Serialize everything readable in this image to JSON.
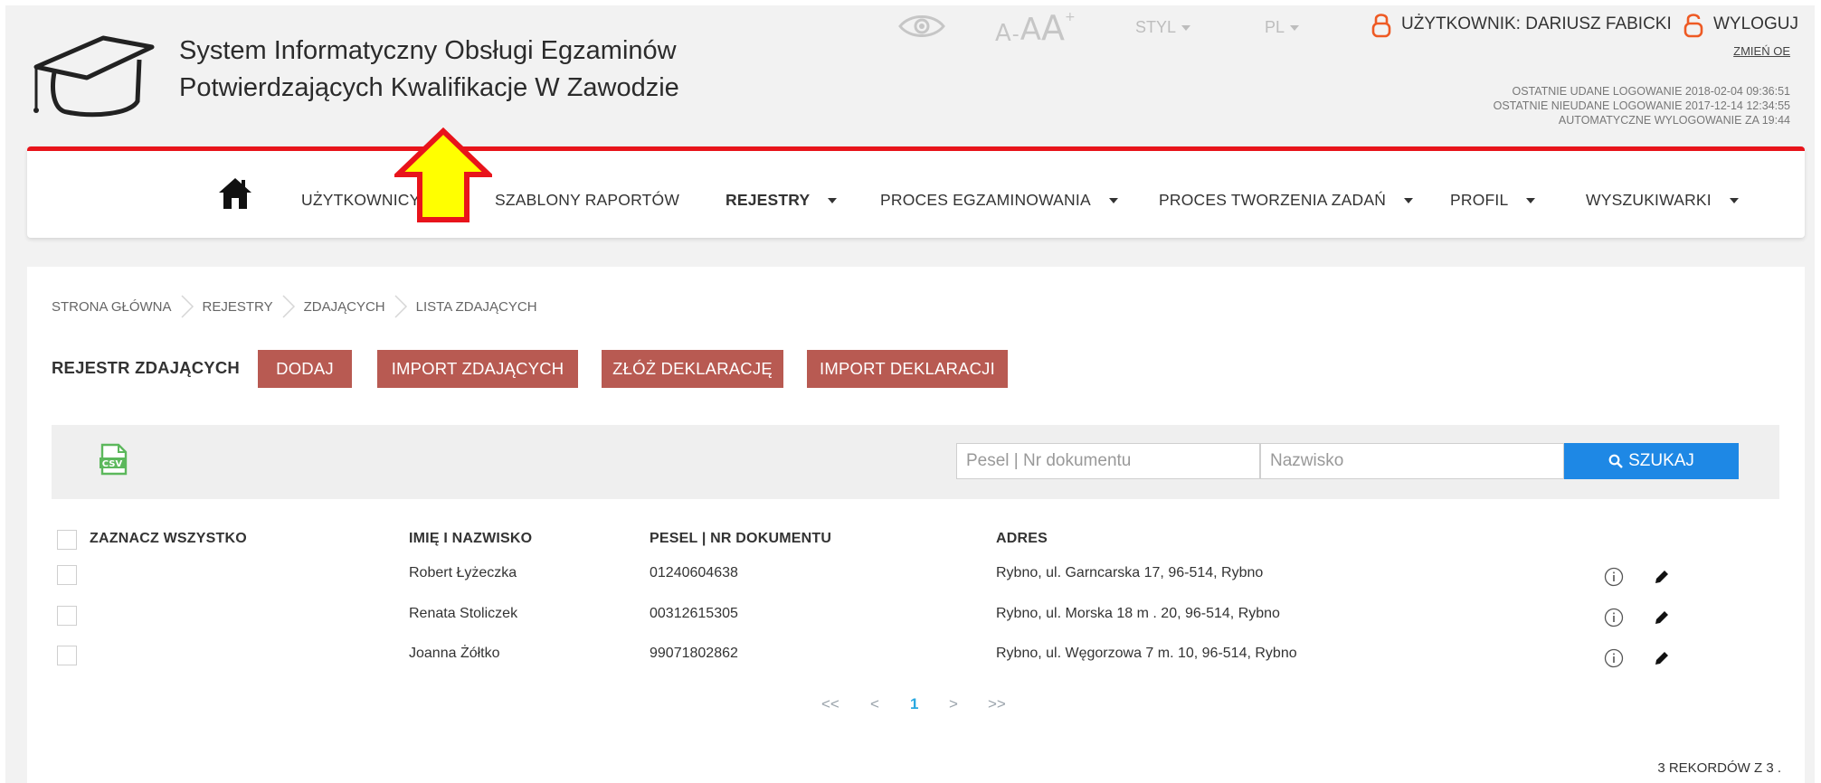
{
  "header": {
    "title_line1": "System Informatyczny Obsługi Egzaminów",
    "title_line2": "Potwierdzających Kwalifikacje W Zawodzie",
    "font_size_a1": "A",
    "font_size_dash": "-",
    "font_size_a2": "A",
    "font_size_a3": "A",
    "font_size_plus": "+",
    "style_label": "STYL",
    "lang_label": "PL",
    "user_label": "UŻYTKOWNIK: DARIUSZ FABICKI",
    "logout_label": "WYLOGUJ",
    "change_oe_label": "ZMIEŃ OE",
    "last_success_login": "OSTATNIE UDANE LOGOWANIE 2018-02-04 09:36:51",
    "last_failed_login": "OSTATNIE NIEUDANE LOGOWANIE 2017-12-14 12:34:55",
    "auto_logout": "AUTOMATYCZNE WYLOGOWANIE ZA  19:44"
  },
  "nav": {
    "items": [
      {
        "label": "UŻYTKOWNICY"
      },
      {
        "label": "SZABLONY RAPORTÓW"
      },
      {
        "label": "REJESTRY"
      },
      {
        "label": "PROCES EGZAMINOWANIA"
      },
      {
        "label": "PROCES TWORZENIA ZADAŃ"
      },
      {
        "label": "PROFIL"
      },
      {
        "label": "WYSZUKIWARKI"
      }
    ]
  },
  "breadcrumb": [
    "STRONA GŁÓWNA",
    "REJESTRY",
    "ZDAJĄCYCH",
    "LISTA ZDAJĄCYCH"
  ],
  "page": {
    "title": "REJESTR ZDAJĄCYCH",
    "add_label": "DODAJ",
    "import_candidates_label": "IMPORT ZDAJĄCYCH",
    "submit_declaration_label": "ZŁÓŻ DEKLARACJĘ",
    "import_declarations_label": "IMPORT DEKLARACJI"
  },
  "search": {
    "pesel_placeholder": "Pesel | Nr dokumentu",
    "surname_placeholder": "Nazwisko",
    "button_label": "SZUKAJ"
  },
  "table": {
    "headers": [
      "ZAZNACZ WSZYSTKO",
      "IMIĘ I NAZWISKO",
      "PESEL | NR DOKUMENTU",
      "ADRES"
    ],
    "rows": [
      {
        "name": "Robert Łyżeczka",
        "pesel": "01240604638",
        "address": "Rybno, ul. Garncarska 17, 96-514, Rybno"
      },
      {
        "name": "Renata Stoliczek",
        "pesel": "00312615305",
        "address": "Rybno, ul. Morska 18 m . 20, 96-514, Rybno"
      },
      {
        "name": "Joanna Żółtko",
        "pesel": "99071802862",
        "address": "Rybno, ul. Węgorzowa 7 m. 10, 96-514, Rybno"
      }
    ]
  },
  "pagination": {
    "first": "<<",
    "prev": "<",
    "current": "1",
    "next": ">",
    "last": ">>"
  },
  "records_summary": "3   REKORDÓW Z   3  .",
  "colors": {
    "accent_red": "#e8141b",
    "button_red": "#b85a52",
    "search_blue": "#1e88e5",
    "pager_blue": "#29a8e0",
    "highlight_arrow": "#ffff00"
  }
}
